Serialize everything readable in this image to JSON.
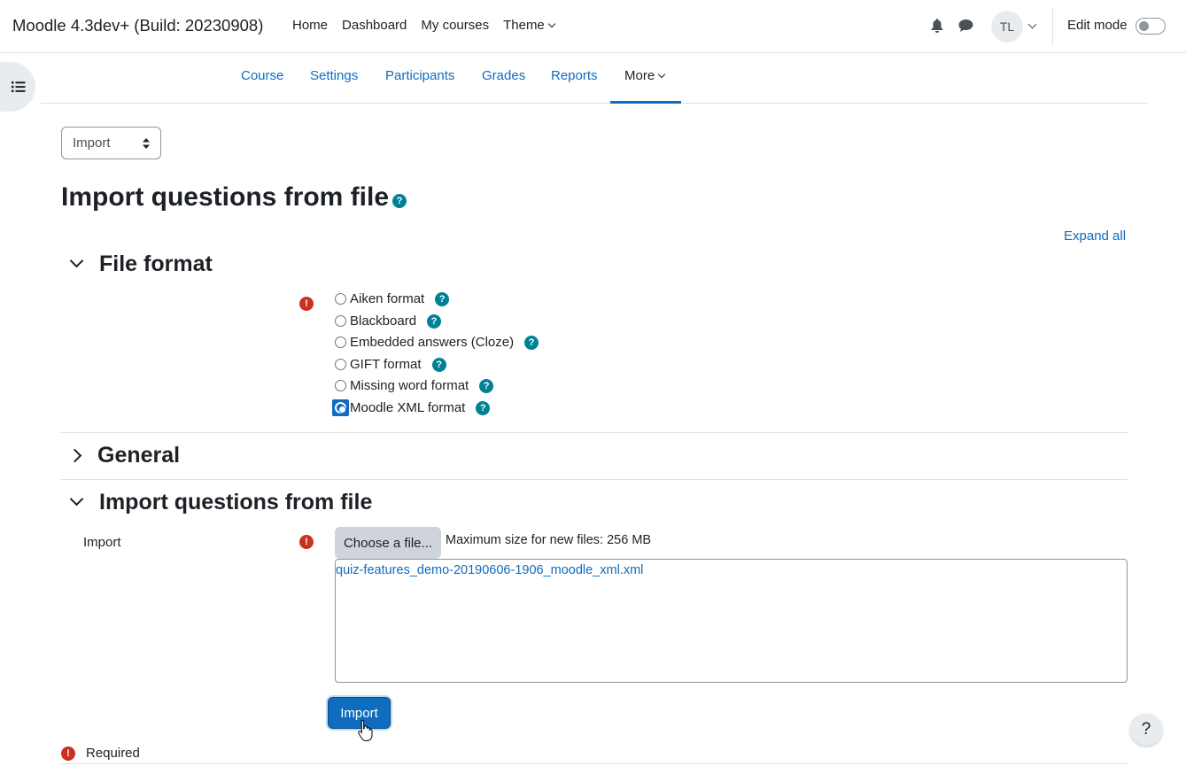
{
  "navbar": {
    "site_name": "Moodle 4.3dev+ (Build: 20230908)",
    "links": [
      "Home",
      "Dashboard",
      "My courses",
      "Theme"
    ],
    "avatar_initials": "TL",
    "edit_mode_label": "Edit mode"
  },
  "secondary_nav": {
    "items": [
      "Course",
      "Settings",
      "Participants",
      "Grades",
      "Reports",
      "More"
    ],
    "active": "More"
  },
  "page_select": {
    "value": "Import"
  },
  "page_title": "Import questions from file",
  "expand_all": "Expand all",
  "sections": {
    "file_format": {
      "title": "File format",
      "options": [
        "Aiken format",
        "Blackboard",
        "Embedded answers (Cloze)",
        "GIFT format",
        "Missing word format",
        "Moodle XML format"
      ],
      "selected": "Moodle XML format"
    },
    "general": {
      "title": "General"
    },
    "import_file": {
      "title": "Import questions from file",
      "field_label": "Import",
      "choose_button": "Choose a file...",
      "max_size": "Maximum size for new files: 256 MB",
      "file_name": "quiz-features_demo-20190606-1906_moodle_xml.xml"
    }
  },
  "submit_button": "Import",
  "required_label": "Required",
  "help_button": "?",
  "colors": {
    "link": "#0f6cbf",
    "help": "#008196",
    "required": "#ca3120"
  }
}
